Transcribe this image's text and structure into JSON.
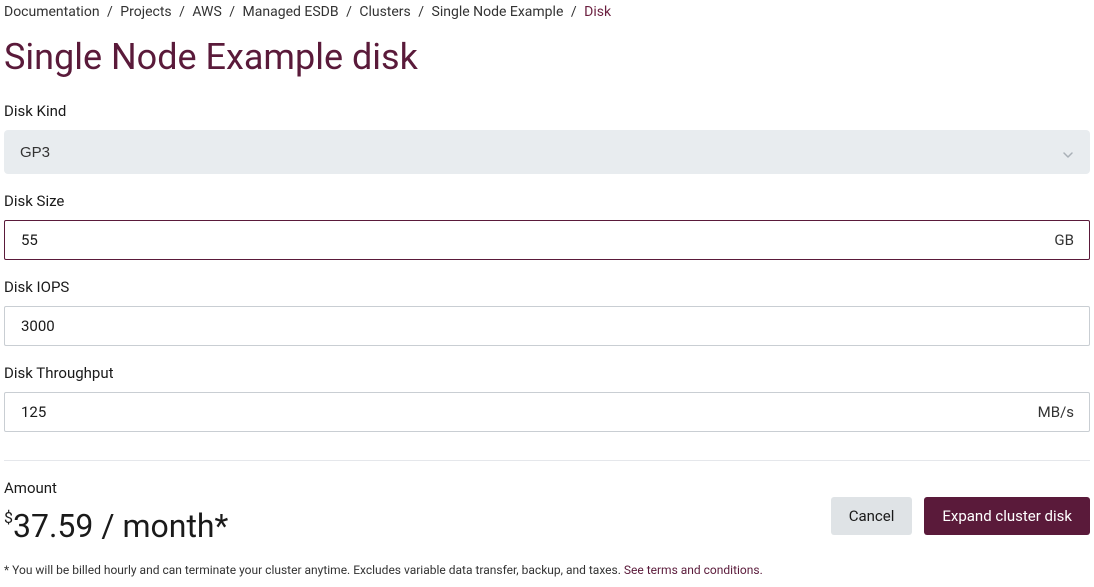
{
  "breadcrumb": {
    "items": [
      "Documentation",
      "Projects",
      "AWS",
      "Managed ESDB",
      "Clusters",
      "Single Node Example"
    ],
    "current": "Disk",
    "separator": "/"
  },
  "page": {
    "title": "Single Node Example disk"
  },
  "fields": {
    "disk_kind": {
      "label": "Disk Kind",
      "value": "GP3"
    },
    "disk_size": {
      "label": "Disk Size",
      "value": "55",
      "suffix": "GB"
    },
    "disk_iops": {
      "label": "Disk IOPS",
      "value": "3000"
    },
    "disk_throughput": {
      "label": "Disk Throughput",
      "value": "125",
      "suffix": "MB/s"
    }
  },
  "amount": {
    "label": "Amount",
    "currency": "$",
    "value": "37.59",
    "period": " / month*"
  },
  "actions": {
    "cancel": "Cancel",
    "expand": "Expand cluster disk"
  },
  "fineprint": {
    "text": "* You will be billed hourly and can terminate your cluster anytime. Excludes variable data transfer, backup, and taxes. ",
    "link_text": "See terms and conditions."
  }
}
